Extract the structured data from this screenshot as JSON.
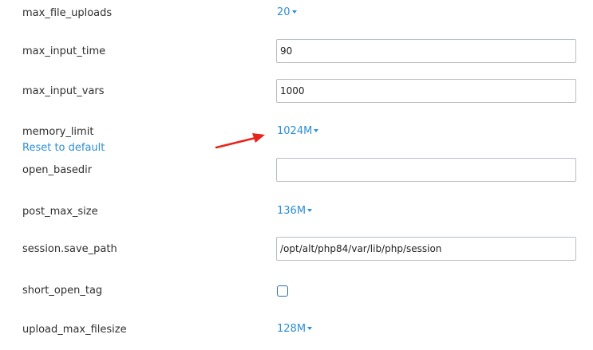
{
  "settings": [
    {
      "name": "max_file_uploads",
      "value": "20"
    },
    {
      "name": "max_input_time",
      "value": "90"
    },
    {
      "name": "max_input_vars",
      "value": "1000"
    },
    {
      "name": "memory_limit",
      "value": "1024M",
      "reset_label": "Reset to default"
    },
    {
      "name": "open_basedir",
      "value": ""
    },
    {
      "name": "post_max_size",
      "value": "136M"
    },
    {
      "name": "session.save_path",
      "value": "/opt/alt/php84/var/lib/php/session"
    },
    {
      "name": "short_open_tag",
      "checked": false
    },
    {
      "name": "upload_max_filesize",
      "value": "128M"
    }
  ],
  "colors": {
    "link": "#2d8fd5",
    "annotation_arrow": "#e8231c"
  }
}
